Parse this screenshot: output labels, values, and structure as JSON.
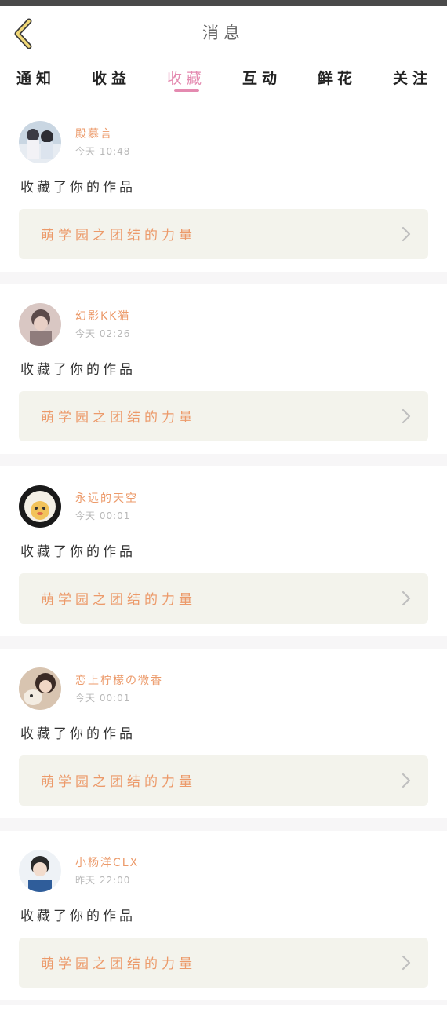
{
  "header": {
    "title": "消息",
    "back_icon": "chevron-left-icon"
  },
  "tabs": [
    {
      "label": "通知",
      "active": false
    },
    {
      "label": "收益",
      "active": false
    },
    {
      "label": "收藏",
      "active": true
    },
    {
      "label": "互动",
      "active": false
    },
    {
      "label": "鲜花",
      "active": false
    },
    {
      "label": "关注",
      "active": false
    }
  ],
  "colors": {
    "accent": "#e48ab0",
    "name": "#ec9a6a",
    "work_bg": "#f3f3ec",
    "time": "#b8b8b8"
  },
  "notifications": [
    {
      "user": "殿慕言",
      "time": "今天 10:48",
      "action": "收藏了你的作品",
      "work": "萌学园之团结的力量"
    },
    {
      "user": "幻影KK猫",
      "time": "今天 02:26",
      "action": "收藏了你的作品",
      "work": "萌学园之团结的力量"
    },
    {
      "user": "永远的天空",
      "time": "今天 00:01",
      "action": "收藏了你的作品",
      "work": "萌学园之团结的力量"
    },
    {
      "user": "恋上柠檬の微香",
      "time": "今天 00:01",
      "action": "收藏了你的作品",
      "work": "萌学园之团结的力量"
    },
    {
      "user": "小杨洋CLX",
      "time": "昨天 22:00",
      "action": "收藏了你的作品",
      "work": "萌学园之团结的力量"
    }
  ]
}
